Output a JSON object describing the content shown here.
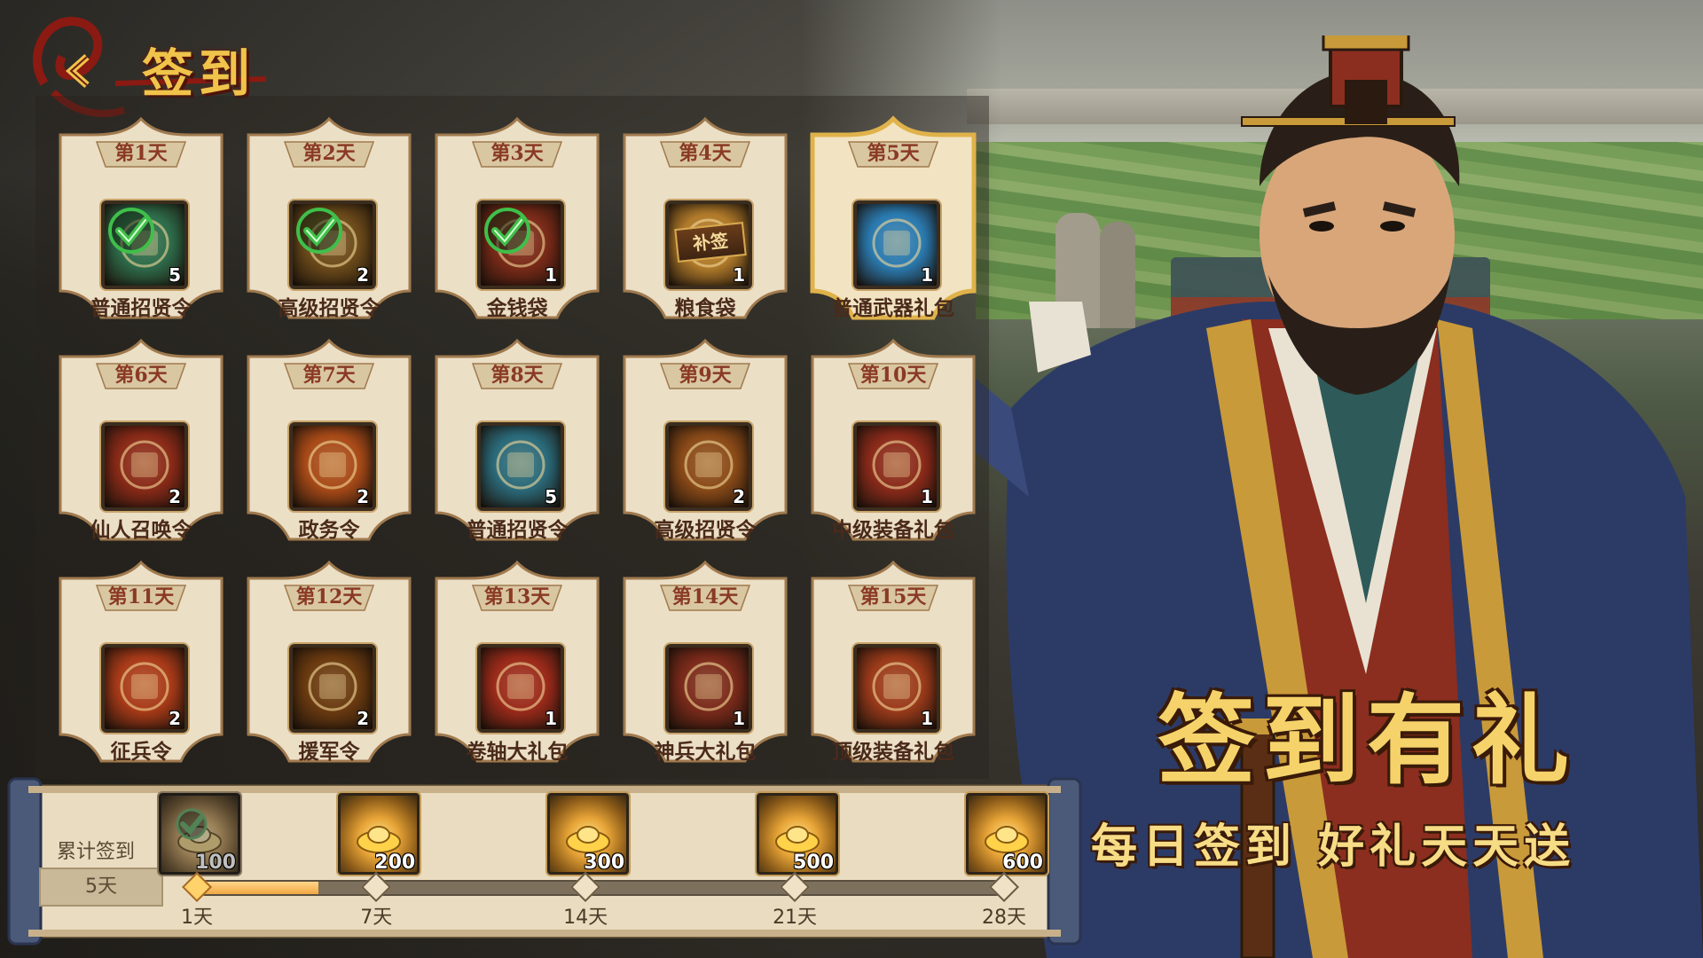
{
  "header": {
    "title": "签到",
    "back_icon": "chevron-left-icon"
  },
  "calendar": [
    {
      "day": "第1天",
      "item": "普通招贤令",
      "qty": "5",
      "icon": "green-scroll-icon",
      "signed": true,
      "makeup": false,
      "highlight": false,
      "color": "#2d6b4a"
    },
    {
      "day": "第2天",
      "item": "高级招贤令",
      "qty": "2",
      "icon": "gold-scroll-icon",
      "signed": true,
      "makeup": false,
      "highlight": false,
      "color": "#6b4a1a"
    },
    {
      "day": "第3天",
      "item": "金钱袋",
      "qty": "1",
      "icon": "money-bag-icon",
      "signed": true,
      "makeup": false,
      "highlight": false,
      "color": "#7a2a18"
    },
    {
      "day": "第4天",
      "item": "粮食袋",
      "qty": "1",
      "icon": "grain-bag-icon",
      "signed": false,
      "makeup": true,
      "makeup_label": "补签",
      "highlight": false,
      "color": "#b07a2a"
    },
    {
      "day": "第5天",
      "item": "普通武器礼包",
      "qty": "1",
      "icon": "weapon-gift-icon",
      "signed": false,
      "makeup": false,
      "highlight": true,
      "color": "#2a7ab0"
    },
    {
      "day": "第6天",
      "item": "仙人召唤令",
      "qty": "2",
      "icon": "immortal-token-icon",
      "signed": false,
      "makeup": false,
      "highlight": false,
      "color": "#8a2a18"
    },
    {
      "day": "第7天",
      "item": "政务令",
      "qty": "2",
      "icon": "scales-token-icon",
      "signed": false,
      "makeup": false,
      "highlight": false,
      "color": "#a84a18"
    },
    {
      "day": "第8天",
      "item": "普通招贤令",
      "qty": "5",
      "icon": "blue-scroll-icon",
      "signed": false,
      "makeup": false,
      "highlight": false,
      "color": "#2a6a7a"
    },
    {
      "day": "第9天",
      "item": "高级招贤令",
      "qty": "2",
      "icon": "gold-scroll-icon",
      "signed": false,
      "makeup": false,
      "highlight": false,
      "color": "#8a4a18"
    },
    {
      "day": "第10天",
      "item": "中级装备礼包",
      "qty": "1",
      "icon": "equipment-chest-icon",
      "signed": false,
      "makeup": false,
      "highlight": false,
      "color": "#8a2a1a"
    },
    {
      "day": "第11天",
      "item": "征兵令",
      "qty": "2",
      "icon": "conscription-token-icon",
      "signed": false,
      "makeup": false,
      "highlight": false,
      "color": "#a83a18"
    },
    {
      "day": "第12天",
      "item": "援军令",
      "qty": "2",
      "icon": "reinforcement-token-icon",
      "signed": false,
      "makeup": false,
      "highlight": false,
      "color": "#6a3a10"
    },
    {
      "day": "第13天",
      "item": "卷轴大礼包",
      "qty": "1",
      "icon": "scroll-chest-icon",
      "signed": false,
      "makeup": false,
      "highlight": false,
      "color": "#9a2a1a"
    },
    {
      "day": "第14天",
      "item": "神兵大礼包",
      "qty": "1",
      "icon": "divine-weapon-chest-icon",
      "signed": false,
      "makeup": false,
      "highlight": false,
      "color": "#7a2a1a"
    },
    {
      "day": "第15天",
      "item": "顶级装备礼包",
      "qty": "1",
      "icon": "top-equipment-chest-icon",
      "signed": false,
      "makeup": false,
      "highlight": false,
      "color": "#9a3a1a"
    }
  ],
  "progress": {
    "label": "累计签到",
    "count": "5天",
    "current_days": 5,
    "max_days": 28,
    "milestones": [
      {
        "day_label": "1天",
        "days": 1,
        "reward": "100",
        "claimed": true
      },
      {
        "day_label": "7天",
        "days": 7,
        "reward": "200",
        "claimed": false
      },
      {
        "day_label": "14天",
        "days": 14,
        "reward": "300",
        "claimed": false
      },
      {
        "day_label": "21天",
        "days": 21,
        "reward": "500",
        "claimed": false
      },
      {
        "day_label": "28天",
        "days": 28,
        "reward": "600",
        "claimed": false
      }
    ]
  },
  "banner": {
    "title": "签到有礼",
    "subtitle": "每日签到 好礼天天送"
  },
  "colors": {
    "gold": "#f0c44a",
    "card": "#ece0c6",
    "card_border": "#a07a4e",
    "ink": "#4a2a1a",
    "check": "#3fbf4a"
  }
}
